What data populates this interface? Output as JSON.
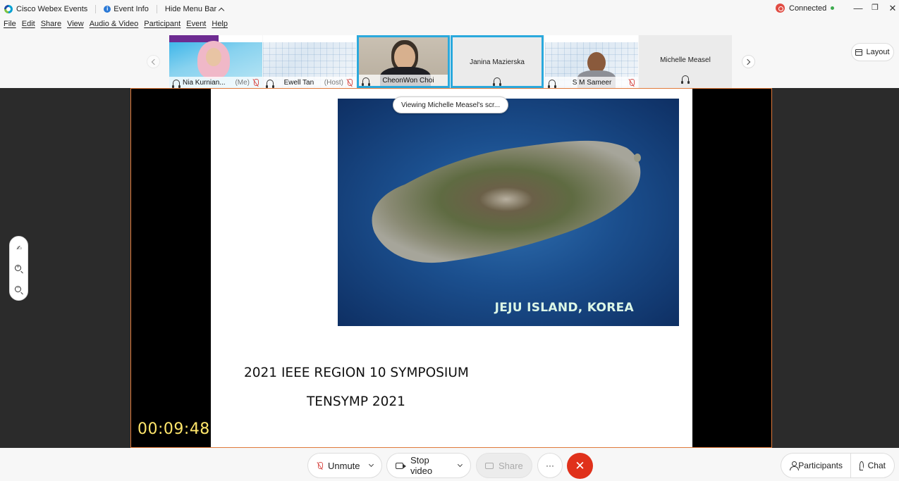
{
  "titlebar": {
    "app_name": "Cisco Webex Events",
    "event_info": "Event Info",
    "hide_menu_bar": "Hide Menu Bar",
    "connection_status": "Connected",
    "minimize_glyph": "—",
    "restore_glyph": "❐",
    "close_glyph": "✕"
  },
  "menubar": {
    "items": [
      "File",
      "Edit",
      "Share",
      "View",
      "Audio & Video",
      "Participant",
      "Event",
      "Help"
    ]
  },
  "filmstrip": {
    "participants": [
      {
        "name": "Nia Kurnian...",
        "suffix": "(Me)",
        "muted": true
      },
      {
        "name": "Ewell Tan",
        "suffix": "(Host)",
        "muted": true
      },
      {
        "name": "CheonWon Choi",
        "suffix": "",
        "muted": false,
        "active": true
      },
      {
        "name": "Janina Mazierska",
        "suffix": "",
        "muted": false,
        "active": true
      },
      {
        "name": "S M Sameer",
        "suffix": "",
        "muted": true
      },
      {
        "name": "Michelle Measel",
        "suffix": "",
        "muted": false
      }
    ],
    "prev_icon": "chevron-left-icon",
    "next_icon": "chevron-right-icon"
  },
  "layout_button": "Layout",
  "stage": {
    "viewing_label": "Viewing Michelle Measel's scr...",
    "image_caption": "JEJU ISLAND, KOREA",
    "slide_line1": "2021 IEEE REGION 10 SYMPOSIUM",
    "slide_line2": "TENSYMP 2021",
    "timer": "00:09:48",
    "frame_color": "#e07a3b"
  },
  "side_tools": {
    "annotate_glyph": "✍",
    "zoom_in_glyph": "+",
    "zoom_out_glyph": "−"
  },
  "controls": {
    "unmute": "Unmute",
    "stop_video": "Stop video",
    "share": "Share",
    "more": "···",
    "end": "✕",
    "participants": "Participants",
    "chat": "Chat",
    "end_color": "#e0311b"
  }
}
